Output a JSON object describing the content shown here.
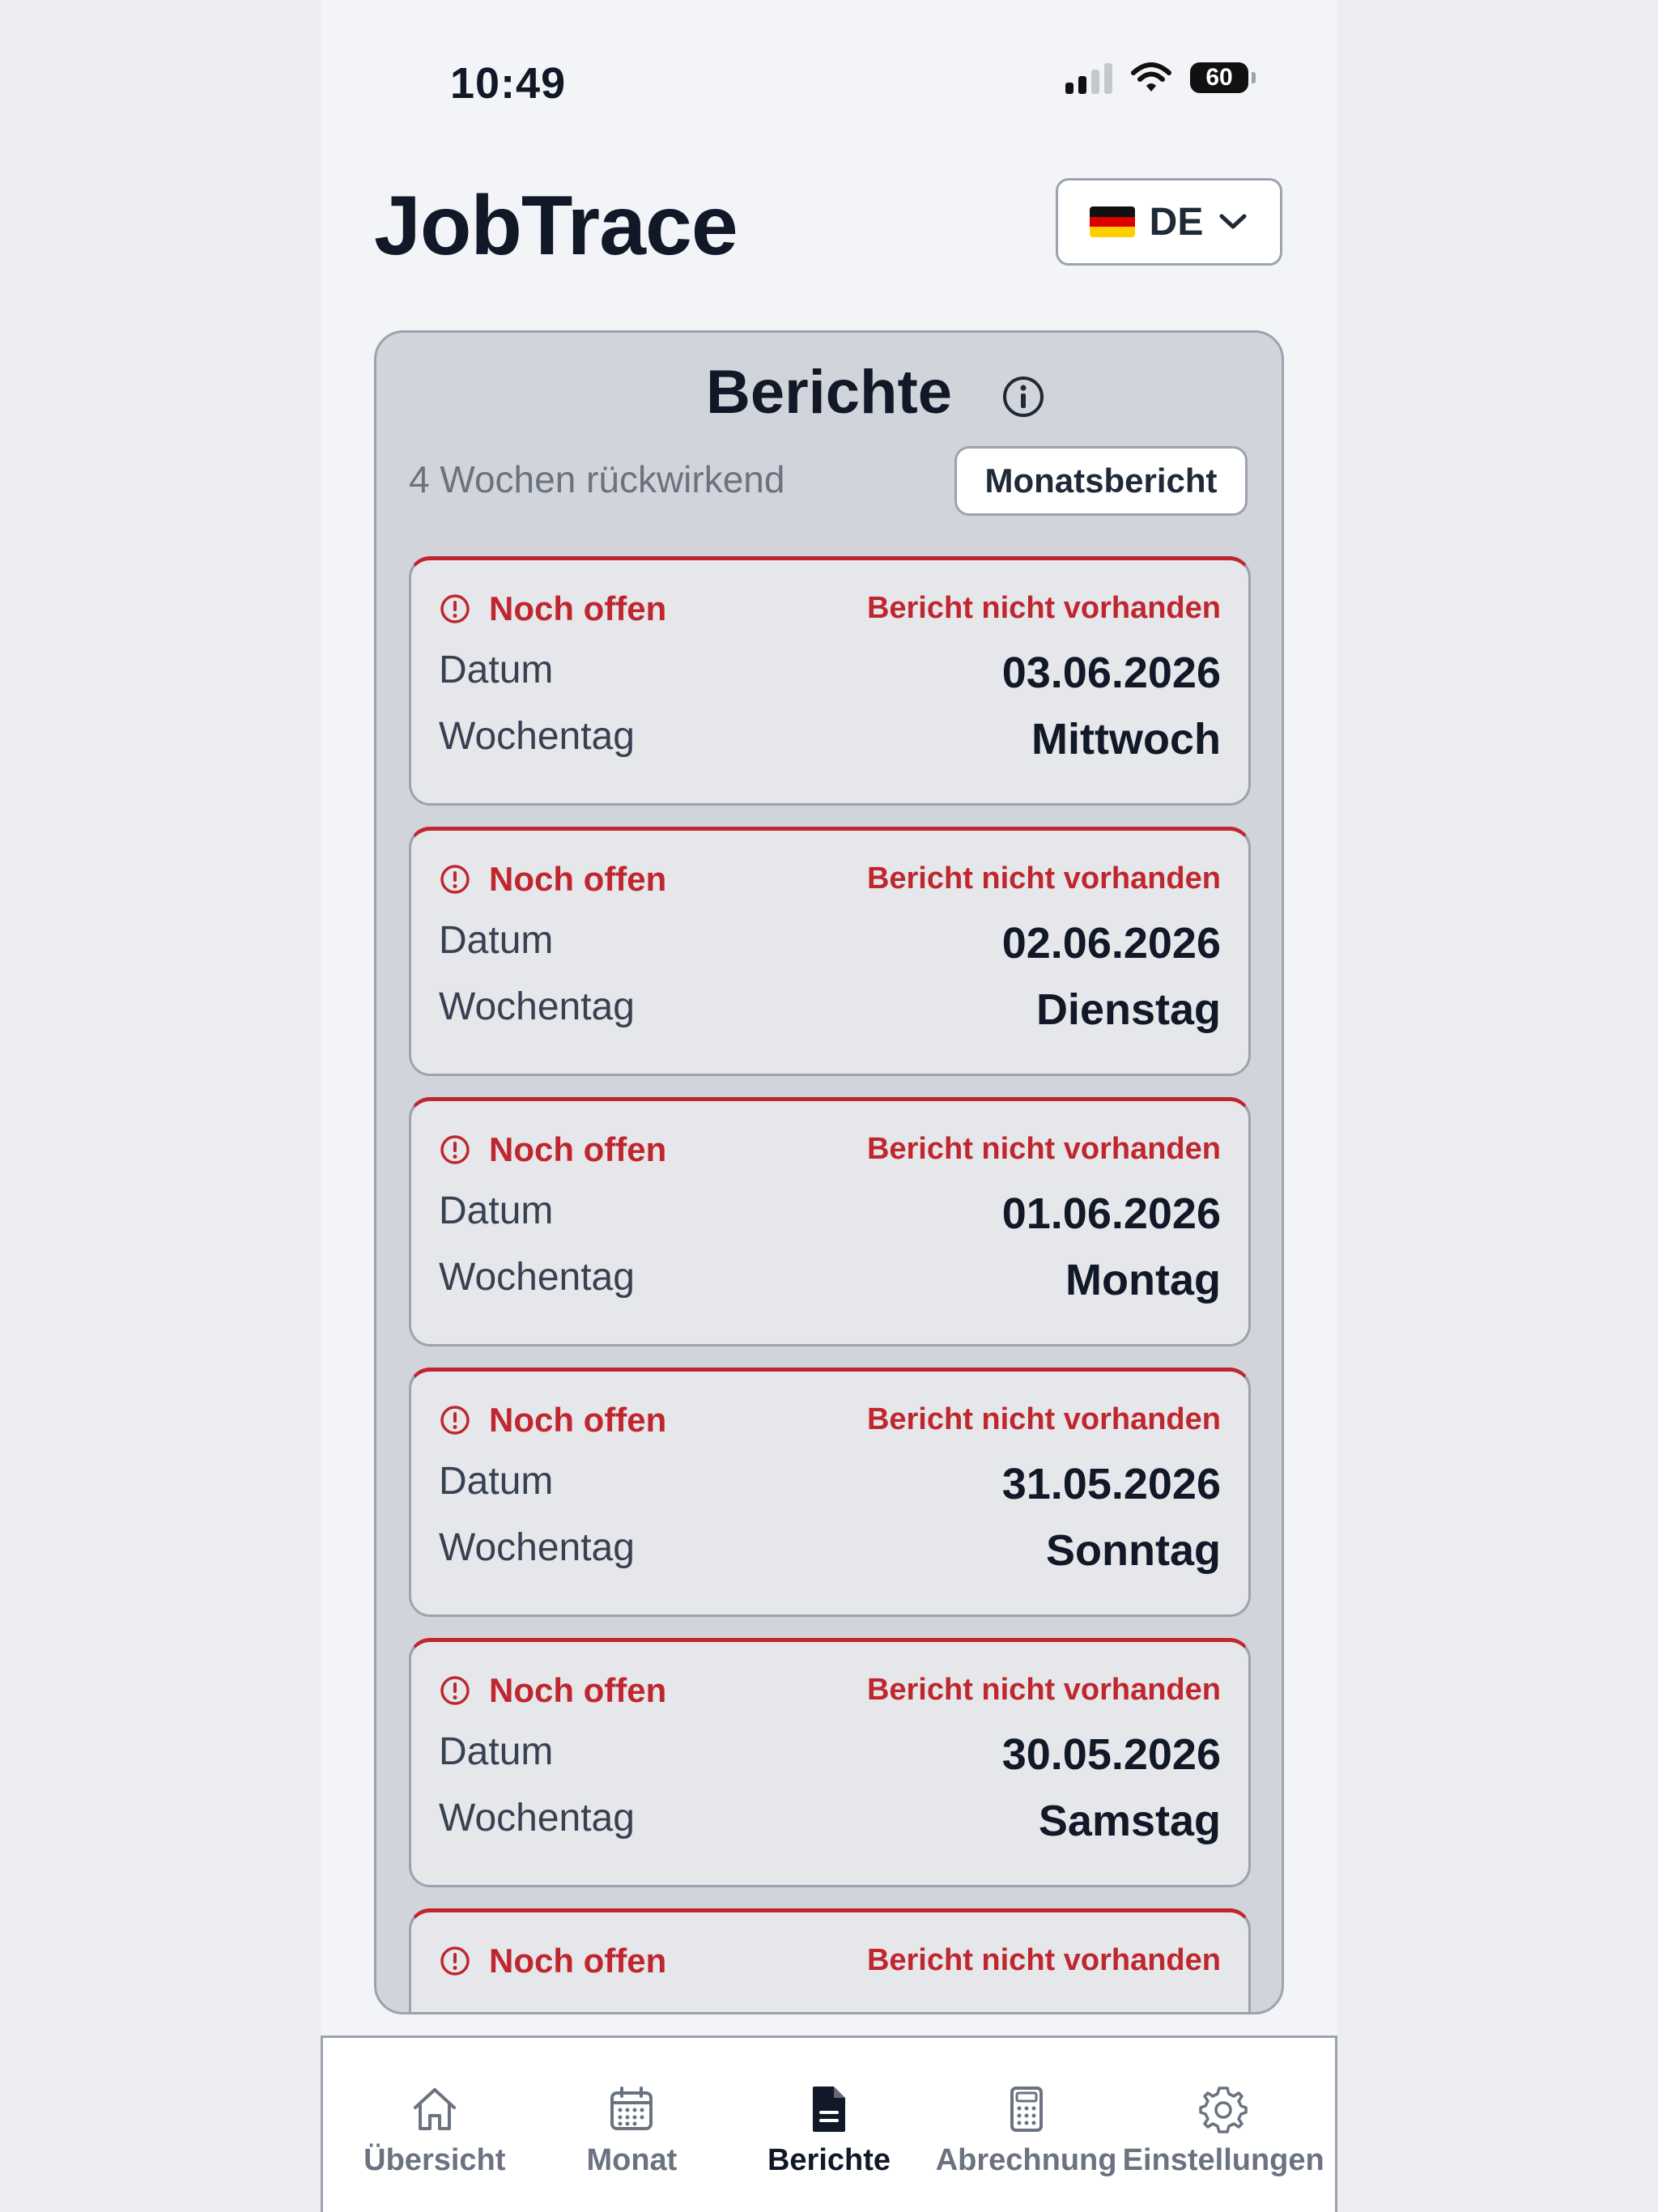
{
  "status_bar": {
    "time": "10:49",
    "battery": "60"
  },
  "header": {
    "app_title": "JobTrace",
    "language": {
      "code": "DE",
      "flag_icon": "germany-flag-icon"
    }
  },
  "reports_panel": {
    "title": "Berichte",
    "subtitle": "4 Wochen rückwirkend",
    "monthly_button": "Monatsbericht",
    "date_label": "Datum",
    "weekday_label": "Wochentag",
    "cards": [
      {
        "status": "Noch offen",
        "note": "Bericht nicht vorhanden",
        "date": "03.06.2026",
        "weekday": "Mittwoch"
      },
      {
        "status": "Noch offen",
        "note": "Bericht nicht vorhanden",
        "date": "02.06.2026",
        "weekday": "Dienstag"
      },
      {
        "status": "Noch offen",
        "note": "Bericht nicht vorhanden",
        "date": "01.06.2026",
        "weekday": "Montag"
      },
      {
        "status": "Noch offen",
        "note": "Bericht nicht vorhanden",
        "date": "31.05.2026",
        "weekday": "Sonntag"
      },
      {
        "status": "Noch offen",
        "note": "Bericht nicht vorhanden",
        "date": "30.05.2026",
        "weekday": "Samstag"
      },
      {
        "status": "Noch offen",
        "note": "Bericht nicht vorhanden",
        "date": "",
        "weekday": ""
      }
    ]
  },
  "bottom_nav": {
    "items": [
      {
        "label": "Übersicht",
        "icon": "home-icon"
      },
      {
        "label": "Monat",
        "icon": "calendar-icon"
      },
      {
        "label": "Berichte",
        "icon": "document-icon",
        "active": true
      },
      {
        "label": "Abrechnung",
        "icon": "calculator-icon"
      },
      {
        "label": "Einstellungen",
        "icon": "gear-icon"
      }
    ]
  },
  "colors": {
    "accent_red": "#c0262d",
    "panel_bg": "#d1d5db",
    "card_bg": "#e5e7eb",
    "text_dark": "#111827"
  }
}
